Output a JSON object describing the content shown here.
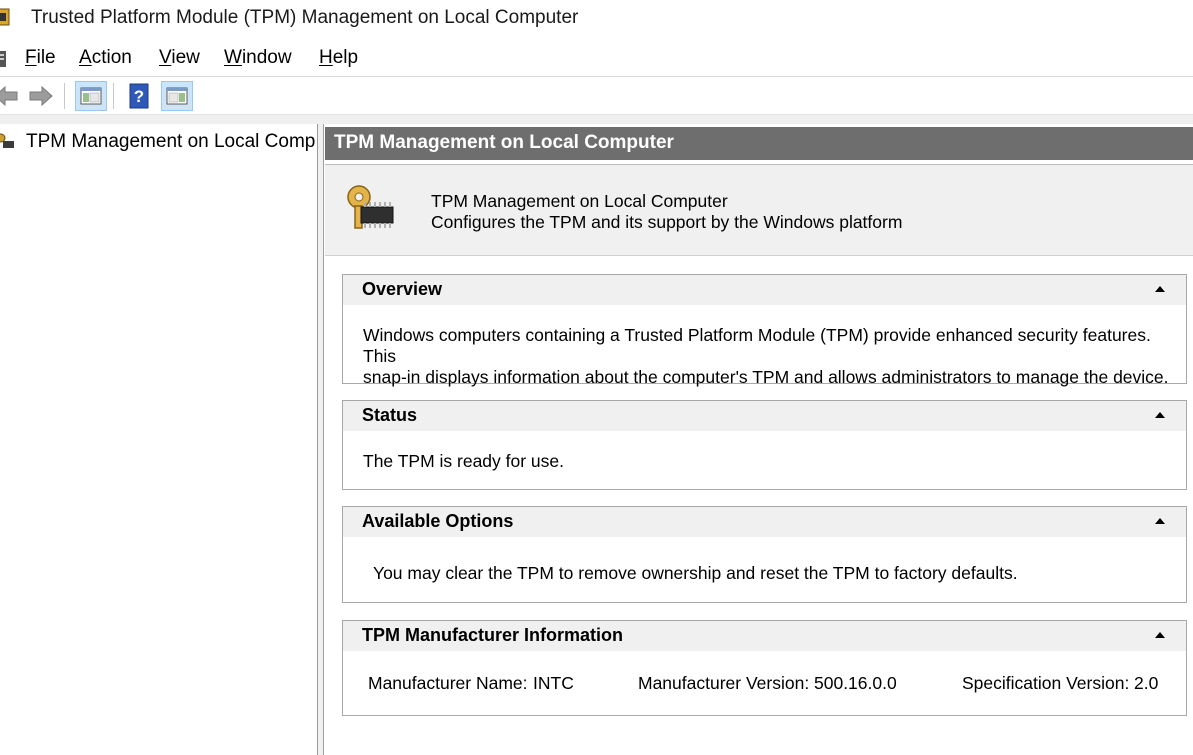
{
  "window": {
    "title": "Trusted Platform Module (TPM) Management on Local Computer"
  },
  "menu": [
    {
      "id": "file",
      "accel": "F",
      "rest": "ile"
    },
    {
      "id": "action",
      "accel": "A",
      "rest": "ction"
    },
    {
      "id": "view",
      "accel": "V",
      "rest": "iew"
    },
    {
      "id": "window",
      "accel": "W",
      "rest": "indow"
    },
    {
      "id": "help",
      "accel": "H",
      "rest": "elp"
    }
  ],
  "toolbar": {
    "icons": [
      "back-arrow-icon",
      "forward-arrow-icon",
      "show-hide-console-tree-icon",
      "help-icon",
      "show-hide-action-pane-icon"
    ]
  },
  "tree": {
    "root_label": "TPM Management on Local Comp"
  },
  "pane": {
    "header": "TPM Management on Local Computer",
    "intro_title": "TPM Management on Local Computer",
    "intro_desc": "Configures the TPM and its support by the Windows platform"
  },
  "sections": {
    "overview": {
      "title": "Overview",
      "line1": "Windows computers containing a Trusted Platform Module (TPM) provide enhanced security features. This",
      "line2": "snap-in displays information about the computer's TPM and allows administrators to manage the device."
    },
    "status": {
      "title": "Status",
      "text": "The TPM is ready for use."
    },
    "options": {
      "title": "Available Options",
      "text": "You may clear the TPM to remove ownership and reset the TPM to factory defaults."
    },
    "manufacturer": {
      "title": "TPM Manufacturer Information",
      "name_label": "Manufacturer Name:",
      "name_value": "INTC",
      "version_label": "Manufacturer Version:",
      "version_value": "500.16.0.0",
      "spec_label": "Specification Version:",
      "spec_value": "2.0"
    }
  }
}
